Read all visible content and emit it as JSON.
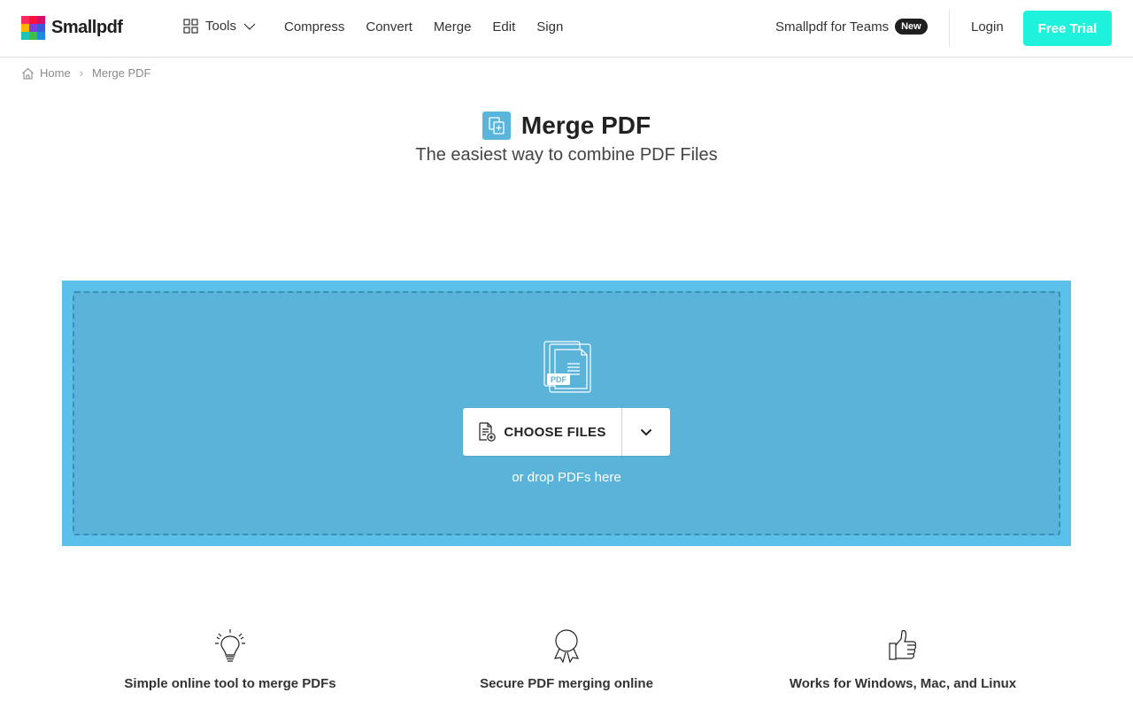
{
  "header": {
    "logo_text": "Smallpdf",
    "tools_label": "Tools",
    "nav": [
      "Compress",
      "Convert",
      "Merge",
      "Edit",
      "Sign"
    ],
    "teams_label": "Smallpdf for Teams",
    "teams_badge": "New",
    "login_label": "Login",
    "trial_label": "Free Trial"
  },
  "breadcrumb": {
    "home": "Home",
    "current": "Merge PDF"
  },
  "hero": {
    "title": "Merge PDF",
    "subtitle": "The easiest way to combine PDF Files"
  },
  "dropzone": {
    "icon_label": "PDF",
    "choose_label": "CHOOSE FILES",
    "hint": "or drop PDFs here"
  },
  "features": [
    {
      "icon": "lightbulb-icon",
      "title": "Simple online tool to merge PDFs"
    },
    {
      "icon": "award-ribbon-icon",
      "title": "Secure PDF merging online"
    },
    {
      "icon": "thumbs-up-icon",
      "title": "Works for Windows, Mac, and Linux"
    }
  ],
  "colors": {
    "accent": "#1ef2dc",
    "dropzone_outer": "#5bc0ea",
    "dropzone_inner": "#5ab4da",
    "title_icon": "#59b5dc"
  }
}
